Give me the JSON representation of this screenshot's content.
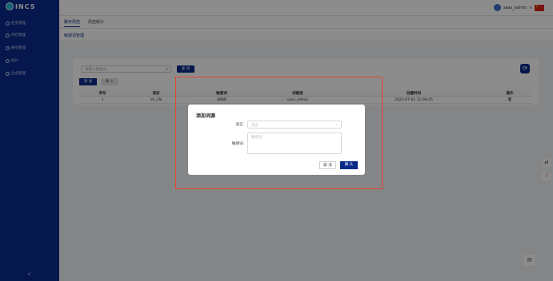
{
  "app": {
    "logo_text": "INCS"
  },
  "sidebar": {
    "items": [
      {
        "label": "任务管理",
        "icon": "task-icon"
      },
      {
        "label": "风控管理",
        "icon": "shield-icon"
      },
      {
        "label": "账号管理",
        "icon": "user-icon"
      },
      {
        "label": "统计",
        "icon": "chart-icon"
      },
      {
        "label": "企业管理",
        "icon": "building-icon"
      }
    ],
    "collapse_glyph": "<"
  },
  "topbar": {
    "username": "saas_admin",
    "caret": "∨"
  },
  "tabs": [
    {
      "label": "聊天风控"
    },
    {
      "label": "风控统计"
    }
  ],
  "subtab": {
    "label": "敏感词管理"
  },
  "toolbar": {
    "search_placeholder": "请输入敏感词",
    "search_icon": "⌕",
    "query_label": "查 询",
    "add_label": "添 加",
    "import_label": "导 入",
    "refresh_glyph": "⟳"
  },
  "table": {
    "headers": [
      "序号",
      "语言",
      "敏感词",
      "创建者",
      "创建时间",
      "操作"
    ],
    "rows": [
      [
        "1",
        "zh_CN",
        "8888",
        "saas_admin",
        "2025-07-01 12:00:45",
        "🗑"
      ]
    ]
  },
  "dialog": {
    "title": "添加词源",
    "language_label": "语言:",
    "language_placeholder": "语言",
    "word_label": "敏感词:",
    "word_placeholder": "敏感词",
    "cancel_label": "取 消",
    "confirm_label": "确 认"
  },
  "colors": {
    "primary": "#0a2a8a",
    "highlight": "#e5452f"
  }
}
